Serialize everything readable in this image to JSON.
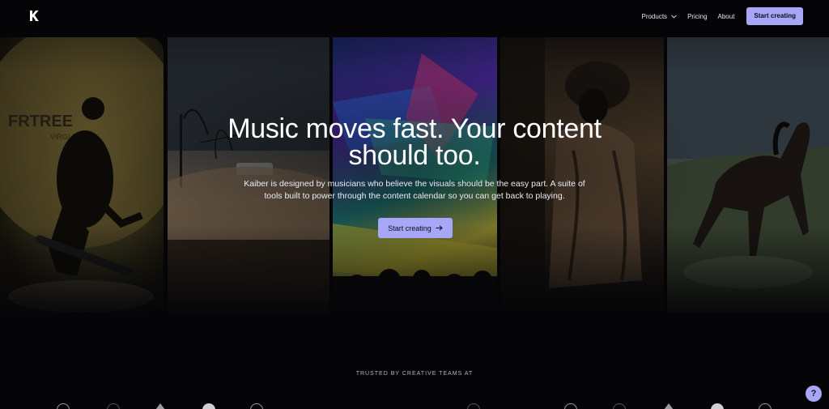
{
  "nav": {
    "logo_icon": "kaiber-k-logo-icon",
    "links": [
      {
        "label": "Products",
        "has_dropdown": true
      },
      {
        "label": "Pricing",
        "has_dropdown": false
      },
      {
        "label": "About",
        "has_dropdown": false
      }
    ],
    "cta_label": "Start creating"
  },
  "hero": {
    "headline": "Music moves fast. Your content should too.",
    "subheadline": "Kaiber is designed by musicians who believe the visuals should be the easy part. A suite of tools built to power through the content calendar so you can get back to playing.",
    "cta_label": "Start creating",
    "cta_icon": "arrow-right-icon"
  },
  "trusted": {
    "label": "TRUSTED BY CREATIVE TEAMS AT"
  },
  "help": {
    "label": "?"
  },
  "colors": {
    "accent": "#a7a6f7",
    "background": "#050507"
  }
}
